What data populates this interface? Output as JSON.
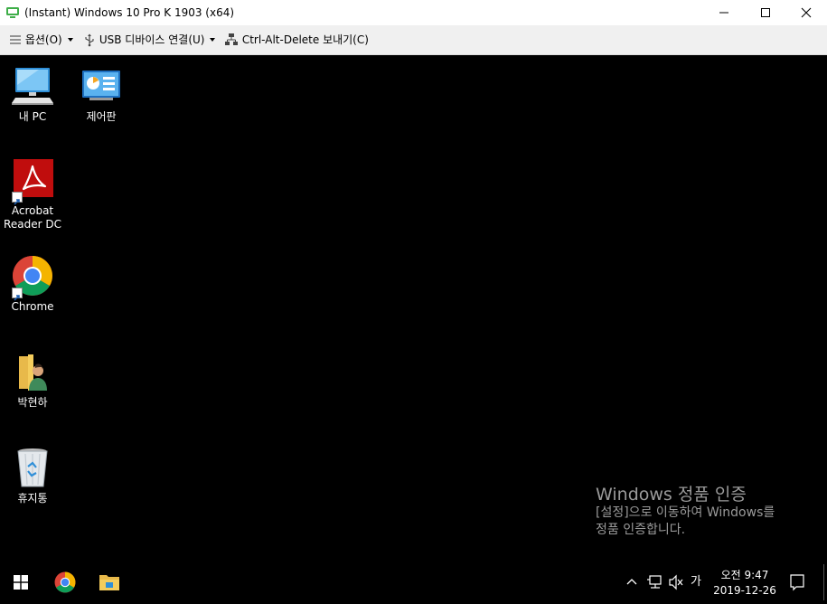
{
  "window": {
    "title": "(Instant) Windows 10 Pro K 1903 (x64)"
  },
  "toolbar": {
    "options_label": "옵션(O)",
    "usb_label": "USB 디바이스 연결(U)",
    "cad_label": "Ctrl-Alt-Delete 보내기(C)"
  },
  "desktop": {
    "icons": [
      {
        "label": "내 PC",
        "icon": "computer-icon"
      },
      {
        "label": "제어판",
        "icon": "control-panel-icon"
      },
      {
        "label_line1": "Acrobat",
        "label_line2": "Reader DC",
        "icon": "acrobat-icon"
      },
      {
        "label": "Chrome",
        "icon": "chrome-icon"
      },
      {
        "label": "박현하",
        "icon": "user-folder-icon"
      },
      {
        "label": "휴지통",
        "icon": "recycle-bin-icon"
      }
    ]
  },
  "activation": {
    "title": "Windows 정품 인증",
    "line1": "[설정]으로 이동하여 Windows를",
    "line2": "정품 인증합니다."
  },
  "taskbar": {
    "ime": "가",
    "time": "오전 9:47",
    "date": "2019-12-26"
  },
  "colors": {
    "desktop": "#000000",
    "toolbar": "#f0f0f0",
    "acrobat": "#c00d0d"
  }
}
